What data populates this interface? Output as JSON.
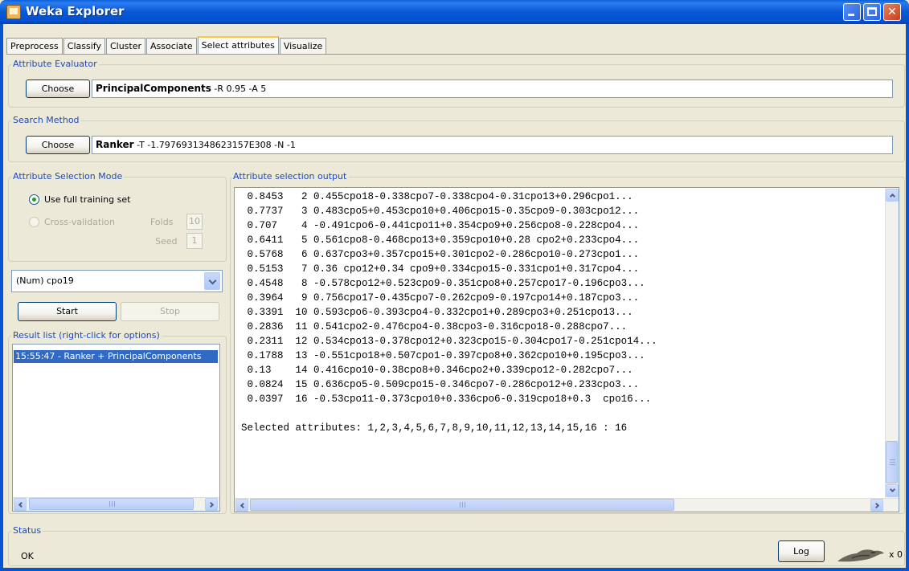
{
  "window": {
    "title": "Weka Explorer"
  },
  "tabs": [
    {
      "label": "Preprocess"
    },
    {
      "label": "Classify"
    },
    {
      "label": "Cluster"
    },
    {
      "label": "Associate"
    },
    {
      "label": "Select attributes"
    },
    {
      "label": "Visualize"
    }
  ],
  "attribute_evaluator": {
    "group_label": "Attribute Evaluator",
    "choose_label": "Choose",
    "name": "PrincipalComponents",
    "options": "-R 0.95 -A 5"
  },
  "search_method": {
    "group_label": "Search Method",
    "choose_label": "Choose",
    "name": "Ranker",
    "options": "-T -1.7976931348623157E308 -N -1"
  },
  "selection_mode": {
    "group_label": "Attribute Selection Mode",
    "full_training_label": "Use full training set",
    "cross_validation_label": "Cross-validation",
    "folds_label": "Folds",
    "folds_value": "10",
    "seed_label": "Seed",
    "seed_value": "1"
  },
  "class_attribute": {
    "selected": "(Num) cpo19"
  },
  "controls": {
    "start_label": "Start",
    "stop_label": "Stop"
  },
  "result_list": {
    "group_label": "Result list (right-click for options)",
    "items": [
      "15:55:47 - Ranker + PrincipalComponents"
    ]
  },
  "output": {
    "group_label": "Attribute selection output",
    "lines": [
      " 0.8453   2 0.455cpo18-0.338cpo7-0.338cpo4-0.31cpo13+0.296cpo1...",
      " 0.7737   3 0.483cpo5+0.453cpo10+0.406cpo15-0.35cpo9-0.303cpo12...",
      " 0.707    4 -0.491cpo6-0.441cpo11+0.354cpo9+0.256cpo8-0.228cpo4...",
      " 0.6411   5 0.561cpo8-0.468cpo13+0.359cpo10+0.28 cpo2+0.233cpo4...",
      " 0.5768   6 0.637cpo3+0.357cpo15+0.301cpo2-0.286cpo10-0.273cpo1...",
      " 0.5153   7 0.36 cpo12+0.34 cpo9+0.334cpo15-0.331cpo1+0.317cpo4...",
      " 0.4548   8 -0.578cpo12+0.523cpo9-0.351cpo8+0.257cpo17-0.196cpo3...",
      " 0.3964   9 0.756cpo17-0.435cpo7-0.262cpo9-0.197cpo14+0.187cpo3...",
      " 0.3391  10 0.593cpo6-0.393cpo4-0.332cpo1+0.289cpo3+0.251cpo13...",
      " 0.2836  11 0.541cpo2-0.476cpo4-0.38cpo3-0.316cpo18-0.288cpo7...",
      " 0.2311  12 0.534cpo13-0.378cpo12+0.323cpo15-0.304cpo17-0.251cpo14...",
      " 0.1788  13 -0.551cpo18+0.507cpo1-0.397cpo8+0.362cpo10+0.195cpo3...",
      " 0.13    14 0.416cpo10-0.38cpo8+0.346cpo2+0.339cpo12-0.282cpo7...",
      " 0.0824  15 0.636cpo5-0.509cpo15-0.346cpo7-0.286cpo12+0.233cpo3...",
      " 0.0397  16 -0.53cpo11-0.373cpo10+0.336cpo6-0.319cpo18+0.3  cpo16...",
      "",
      "Selected attributes: 1,2,3,4,5,6,7,8,9,10,11,12,13,14,15,16 : 16"
    ]
  },
  "status": {
    "group_label": "Status",
    "text": "OK",
    "log_label": "Log",
    "count": "x 0"
  },
  "colors": {
    "titlebar": "#0858d6",
    "group_label": "#1d49b8",
    "selection": "#316ac5"
  }
}
